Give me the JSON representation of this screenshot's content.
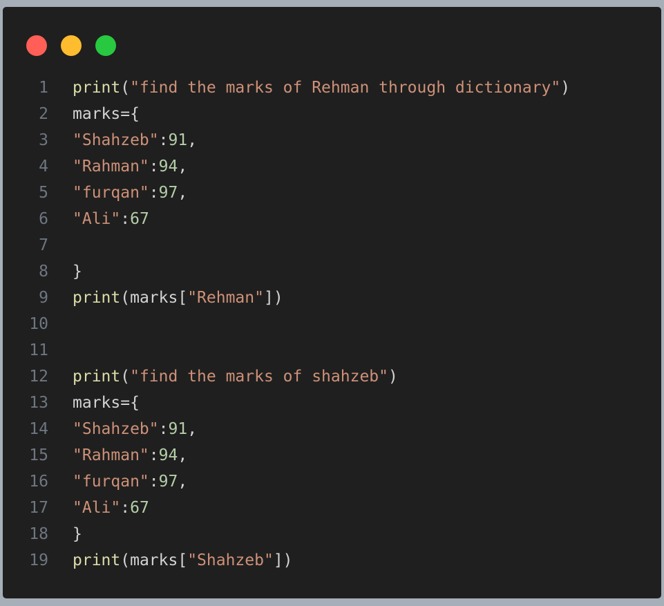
{
  "colors": {
    "background": "#a6afb8",
    "window": "#1f1f1f",
    "dot_red": "#ff5f57",
    "dot_yellow": "#febc2e",
    "dot_green": "#28c840",
    "line_number": "#6e7681",
    "function": "#dcdcaa",
    "string": "#ce9178",
    "number": "#b5cea8",
    "plain": "#d4d4d4"
  },
  "window_controls": [
    "close-dot",
    "minimize-dot",
    "maximize-dot"
  ],
  "lines": [
    {
      "n": "1",
      "tokens": [
        {
          "t": "print",
          "k": "function"
        },
        {
          "t": "(",
          "k": "plain"
        },
        {
          "t": "\"find the marks of Rehman through dictionary\"",
          "k": "string"
        },
        {
          "t": ")",
          "k": "plain"
        }
      ]
    },
    {
      "n": "2",
      "tokens": [
        {
          "t": "marks={",
          "k": "plain"
        }
      ]
    },
    {
      "n": "3",
      "tokens": [
        {
          "t": "\"Shahzeb\"",
          "k": "string"
        },
        {
          "t": ":",
          "k": "plain"
        },
        {
          "t": "91",
          "k": "number"
        },
        {
          "t": ",",
          "k": "plain"
        }
      ]
    },
    {
      "n": "4",
      "tokens": [
        {
          "t": "\"Rahman\"",
          "k": "string"
        },
        {
          "t": ":",
          "k": "plain"
        },
        {
          "t": "94",
          "k": "number"
        },
        {
          "t": ",",
          "k": "plain"
        }
      ]
    },
    {
      "n": "5",
      "tokens": [
        {
          "t": "\"furqan\"",
          "k": "string"
        },
        {
          "t": ":",
          "k": "plain"
        },
        {
          "t": "97",
          "k": "number"
        },
        {
          "t": ",",
          "k": "plain"
        }
      ]
    },
    {
      "n": "6",
      "tokens": [
        {
          "t": "\"Ali\"",
          "k": "string"
        },
        {
          "t": ":",
          "k": "plain"
        },
        {
          "t": "67",
          "k": "number"
        }
      ]
    },
    {
      "n": "7",
      "tokens": []
    },
    {
      "n": "8",
      "tokens": [
        {
          "t": "}",
          "k": "plain"
        }
      ]
    },
    {
      "n": "9",
      "tokens": [
        {
          "t": "print",
          "k": "function"
        },
        {
          "t": "(marks[",
          "k": "plain"
        },
        {
          "t": "\"Rehman\"",
          "k": "string"
        },
        {
          "t": "])",
          "k": "plain"
        }
      ]
    },
    {
      "n": "10",
      "tokens": []
    },
    {
      "n": "11",
      "tokens": []
    },
    {
      "n": "12",
      "tokens": [
        {
          "t": "print",
          "k": "function"
        },
        {
          "t": "(",
          "k": "plain"
        },
        {
          "t": "\"find the marks of shahzeb\"",
          "k": "string"
        },
        {
          "t": ")",
          "k": "plain"
        }
      ]
    },
    {
      "n": "13",
      "tokens": [
        {
          "t": "marks={",
          "k": "plain"
        }
      ]
    },
    {
      "n": "14",
      "tokens": [
        {
          "t": "\"Shahzeb\"",
          "k": "string"
        },
        {
          "t": ":",
          "k": "plain"
        },
        {
          "t": "91",
          "k": "number"
        },
        {
          "t": ",",
          "k": "plain"
        }
      ]
    },
    {
      "n": "15",
      "tokens": [
        {
          "t": "\"Rahman\"",
          "k": "string"
        },
        {
          "t": ":",
          "k": "plain"
        },
        {
          "t": "94",
          "k": "number"
        },
        {
          "t": ",",
          "k": "plain"
        }
      ]
    },
    {
      "n": "16",
      "tokens": [
        {
          "t": "\"furqan\"",
          "k": "string"
        },
        {
          "t": ":",
          "k": "plain"
        },
        {
          "t": "97",
          "k": "number"
        },
        {
          "t": ",",
          "k": "plain"
        }
      ]
    },
    {
      "n": "17",
      "tokens": [
        {
          "t": "\"Ali\"",
          "k": "string"
        },
        {
          "t": ":",
          "k": "plain"
        },
        {
          "t": "67",
          "k": "number"
        }
      ]
    },
    {
      "n": "18",
      "tokens": [
        {
          "t": "}",
          "k": "plain"
        }
      ]
    },
    {
      "n": "19",
      "tokens": [
        {
          "t": "print",
          "k": "function"
        },
        {
          "t": "(marks[",
          "k": "plain"
        },
        {
          "t": "\"Shahzeb\"",
          "k": "string"
        },
        {
          "t": "])",
          "k": "plain"
        }
      ]
    }
  ]
}
